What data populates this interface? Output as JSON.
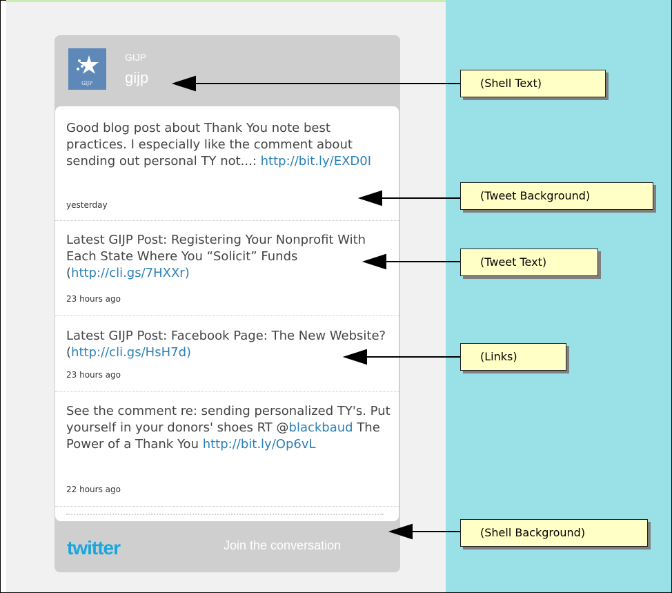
{
  "widget": {
    "header": {
      "name": "GIJP",
      "handle": "gijp",
      "avatar_caption": "GIJP"
    },
    "tweets": [
      {
        "text": "Good blog post about Thank You note best practices. I especially like the comment about sending out personal TY not...: ",
        "link": "http://bit.ly/EXD0I",
        "time": "yesterday"
      },
      {
        "text": "Latest GIJP Post: Registering Your Nonprofit With Each State Where You “Solicit” Funds (",
        "link": "http://cli.gs/7HXXr)",
        "time": "23 hours ago"
      },
      {
        "text": "Latest GIJP Post: Facebook Page: The New Website? (",
        "link": "http://cli.gs/HsH7d)",
        "time": "23 hours ago"
      },
      {
        "text_a": "See the comment re: sending personalized TY's. Put yourself in your donors' shoes RT @",
        "link_a": "blackbaud",
        "text_b": " The Power of a Thank You ",
        "link_b": "http://bit.ly/Op6vL",
        "time": "22 hours ago"
      }
    ],
    "footer": {
      "brand": "twitter",
      "cta": "Join the conversation"
    }
  },
  "callouts": [
    {
      "label": "(Shell Text)"
    },
    {
      "label": "(Tweet Background)"
    },
    {
      "label": "(Tweet Text)"
    },
    {
      "label": "(Links)"
    },
    {
      "label": "(Shell Background)"
    }
  ],
  "colors": {
    "right_panel": "#99e1e6",
    "shell": "#cfcfcf",
    "link": "#2b80b8",
    "callout_bg": "#ffffc6"
  }
}
